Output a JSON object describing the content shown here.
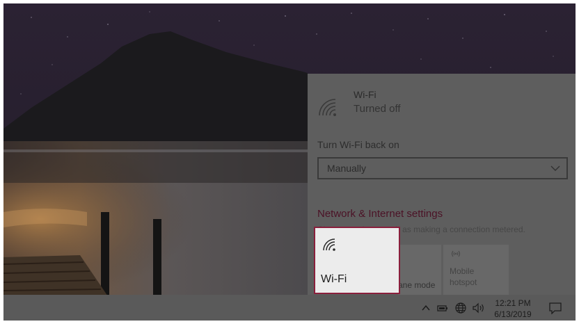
{
  "flyout": {
    "wifi_name": "Wi-Fi",
    "wifi_status": "Turned off",
    "turn_back_label": "Turn Wi-Fi back on",
    "turn_back_value": "Manually",
    "settings_link": "Network & Internet settings",
    "settings_desc": "Change settings, such as making a connection metered.",
    "tiles": {
      "airplane_label": "ane mode",
      "hotspot_label": "Mobile hotspot"
    }
  },
  "highlight_tile": {
    "label": "Wi-Fi",
    "icon": "wifi-icon",
    "border_color": "#8a1f3c"
  },
  "taskbar": {
    "time": "12:21 PM",
    "date": "6/13/2019",
    "icons": [
      "chevron-up-icon",
      "battery-icon",
      "globe-icon",
      "volume-icon",
      "action-center-icon"
    ]
  },
  "colors": {
    "accent_link": "#4b1226",
    "flyout_bg": "#5e5e5e",
    "taskbar_bg": "#5a5a5a"
  }
}
